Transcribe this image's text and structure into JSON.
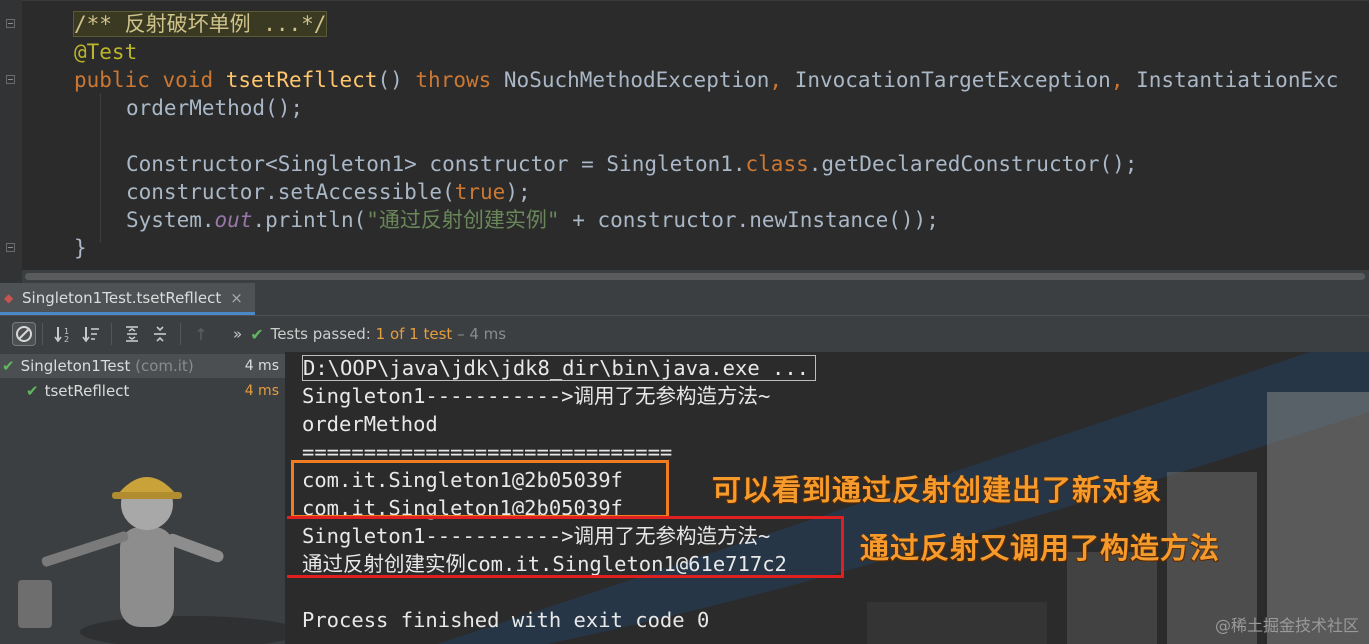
{
  "editor": {
    "lines": {
      "comment": "/** 反射破坏单例 ...*/",
      "annotation": "@Test",
      "public_kw": "public",
      "void_kw": "void",
      "method_name": "tsetRefllect",
      "sig_rest_1": "() ",
      "throws_kw": "throws",
      "exc1": " NoSuchMethodException",
      "comma1": ",",
      "exc2": " InvocationTargetException",
      "comma2": ",",
      "exc3": " InstantiationExc",
      "call_order": "orderMethod();",
      "ctor_decl_1": "Constructor<Singleton1> constructor = Singleton1.",
      "class_kw": "class",
      "ctor_decl_2": ".getDeclaredConstructor();",
      "set_access_1": "constructor.setAccessible(",
      "true_kw": "true",
      "set_access_2": ");",
      "print_1": "System.",
      "out_field": "out",
      "print_2": ".println(",
      "print_str": "\"通过反射创建实例\"",
      "print_3": " + constructor.newInstance());",
      "close_brace": "}"
    }
  },
  "run_tab": {
    "label": "Singleton1Test.tsetRefllect",
    "close": "×"
  },
  "toolbar": {
    "more": "»",
    "status_prefix": "Tests passed: ",
    "passed_count": "1",
    "of_text": " of 1 test",
    "duration": " – 4 ms"
  },
  "tree": {
    "items": [
      {
        "label": "Singleton1Test",
        "package": " (com.it)",
        "time": "4 ms"
      },
      {
        "label": "tsetRefllect",
        "time": "4 ms"
      }
    ]
  },
  "console": {
    "lines": [
      "D:\\OOP\\java\\jdk\\jdk8_dir\\bin\\java.exe ...",
      "Singleton1----------->调用了无参构造方法~",
      "orderMethod",
      "==============================",
      "com.it.Singleton1@2b05039f",
      "com.it.Singleton1@2b05039f",
      "Singleton1----------->调用了无参构造方法~",
      "通过反射创建实例com.it.Singleton1@61e717c2",
      "",
      "Process finished with exit code 0"
    ]
  },
  "annotations": {
    "orange_note": "可以看到通过反射创建出了新对象",
    "red_note": "通过反射又调用了构造方法"
  },
  "watermark": "@稀土掘金技术社区",
  "colors": {
    "passed_green": "#5fb85f",
    "annotation_orange": "#f59a2b",
    "box_orange": "#f07b21",
    "box_red": "#e01f1f",
    "tab_underline": "#4a88c7"
  }
}
